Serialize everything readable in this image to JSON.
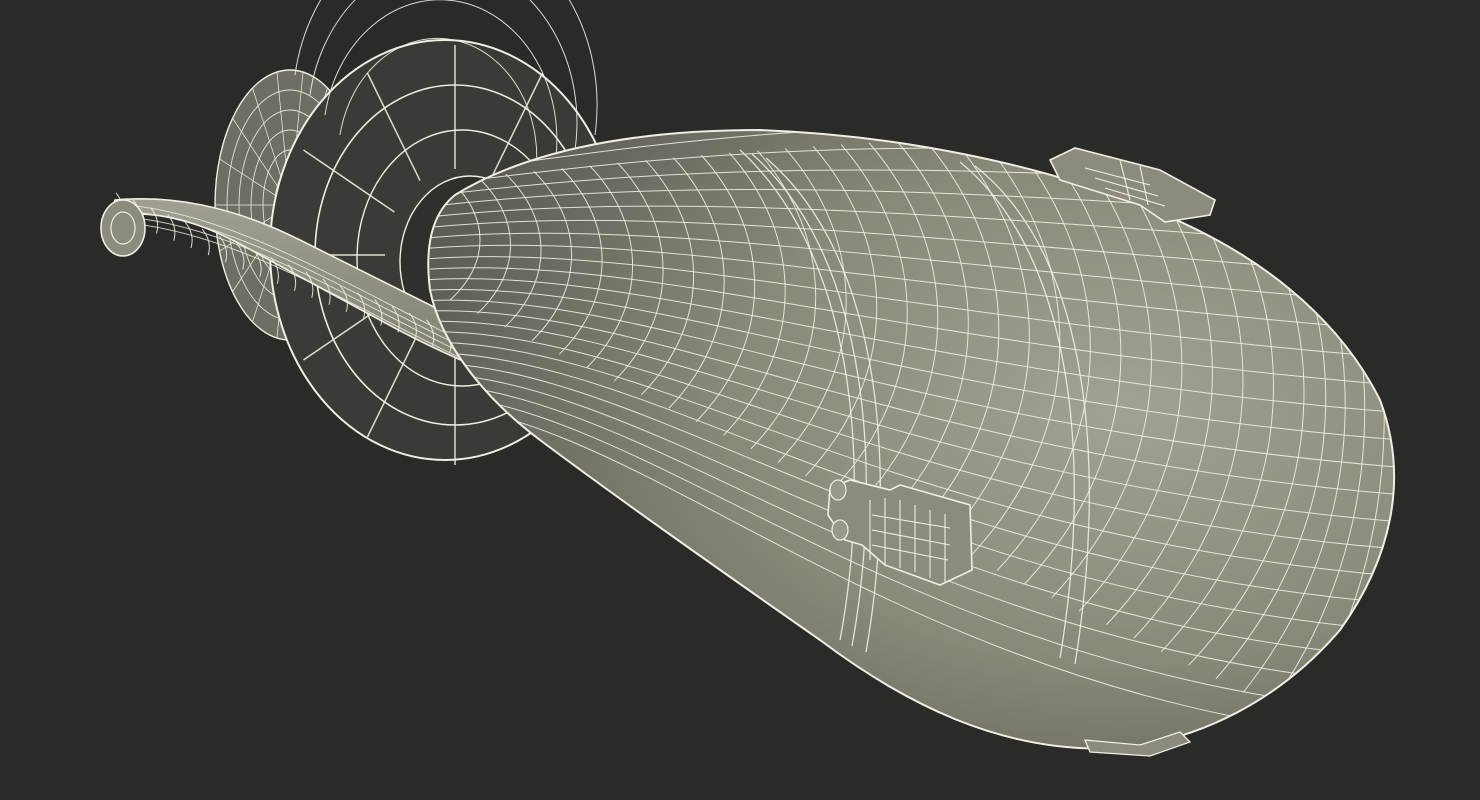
{
  "scene": {
    "subject": "wireframe-3d-model",
    "colors": {
      "background": "#2a2a29",
      "surface": "#8c8a7c",
      "surface_shadow": "#5e5d53",
      "surface_light": "#a3a193",
      "wire": "#f0eee2",
      "dark_inner": "#333330"
    }
  }
}
